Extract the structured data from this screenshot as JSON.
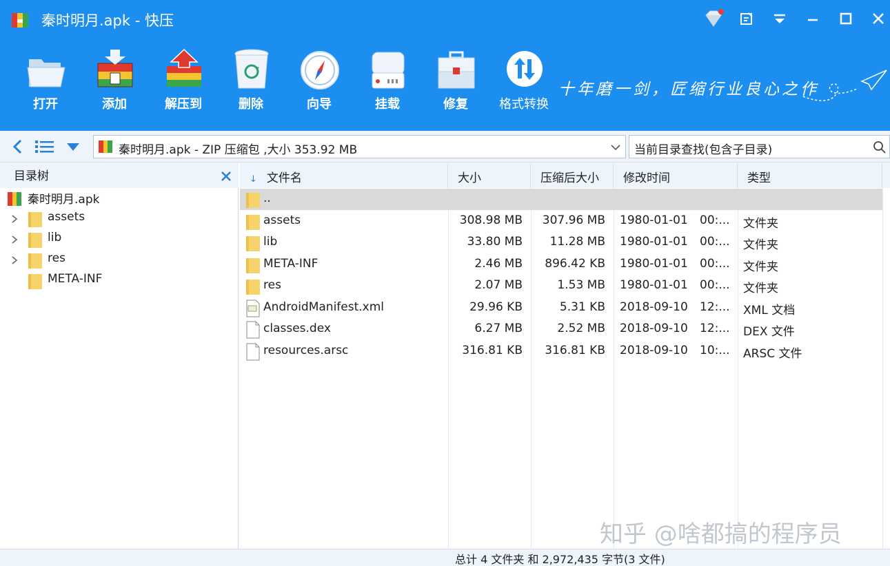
{
  "window": {
    "title": "秦时明月.apk - 快压",
    "controls": [
      "diamond-icon",
      "note-icon",
      "menu-icon",
      "minimize-icon",
      "maximize-icon",
      "close-icon"
    ]
  },
  "toolbar": {
    "items": [
      {
        "label": "打开",
        "icon": "open-folder-icon"
      },
      {
        "label": "添加",
        "icon": "add-archive-icon"
      },
      {
        "label": "解压到",
        "icon": "extract-icon"
      },
      {
        "label": "删除",
        "icon": "recycle-bin-icon"
      },
      {
        "label": "向导",
        "icon": "compass-icon"
      },
      {
        "label": "挂载",
        "icon": "mount-drive-icon"
      },
      {
        "label": "修复",
        "icon": "repair-toolbox-icon"
      },
      {
        "label": "格式转换",
        "icon": "convert-icon"
      }
    ],
    "slogan": "十年磨一剑，匠缩行业良心之作"
  },
  "address": {
    "path": "秦时明月.apk - ZIP 压缩包 ,大小 353.92 MB",
    "search_placeholder": "当前目录查找(包含子目录)"
  },
  "tree": {
    "title": "目录树",
    "root": "秦时明月.apk",
    "items": [
      {
        "label": "assets",
        "expandable": true
      },
      {
        "label": "lib",
        "expandable": true
      },
      {
        "label": "res",
        "expandable": true
      },
      {
        "label": "META-INF",
        "expandable": false
      }
    ]
  },
  "list": {
    "columns": [
      "文件名",
      "大小",
      "压缩后大小",
      "修改时间",
      "类型"
    ],
    "rows": [
      {
        "name": "..",
        "size": "",
        "packed": "",
        "date": "",
        "time": "",
        "type": "",
        "icon": "folder"
      },
      {
        "name": "assets",
        "size": "308.98 MB",
        "packed": "307.96 MB",
        "date": "1980-01-01",
        "time": "00:...",
        "type": "文件夹",
        "icon": "folder"
      },
      {
        "name": "lib",
        "size": "33.80 MB",
        "packed": "11.28 MB",
        "date": "1980-01-01",
        "time": "00:...",
        "type": "文件夹",
        "icon": "folder"
      },
      {
        "name": "META-INF",
        "size": "2.46 MB",
        "packed": "896.42 KB",
        "date": "1980-01-01",
        "time": "00:...",
        "type": "文件夹",
        "icon": "folder"
      },
      {
        "name": "res",
        "size": "2.07 MB",
        "packed": "1.53 MB",
        "date": "1980-01-01",
        "time": "00:...",
        "type": "文件夹",
        "icon": "folder"
      },
      {
        "name": "AndroidManifest.xml",
        "size": "29.96 KB",
        "packed": "5.31 KB",
        "date": "2018-09-10",
        "time": "12:...",
        "type": "XML 文档",
        "icon": "xml"
      },
      {
        "name": "classes.dex",
        "size": "6.27 MB",
        "packed": "2.52 MB",
        "date": "2018-09-10",
        "time": "12:...",
        "type": "DEX 文件",
        "icon": "file"
      },
      {
        "name": "resources.arsc",
        "size": "316.81 KB",
        "packed": "316.81 KB",
        "date": "2018-09-10",
        "time": "10:...",
        "type": "ARSC 文件",
        "icon": "file"
      }
    ]
  },
  "status": {
    "text": "总计 4 文件夹  和  2,972,435 字节(3 文件)"
  },
  "watermark": "知乎 @啥都搞的程序员",
  "colors": {
    "toolbar_bg": "#1b8ef0",
    "pane_bg": "#eef4fb",
    "selected_row": "#d9d9d9",
    "folder": "#f7d46b"
  }
}
